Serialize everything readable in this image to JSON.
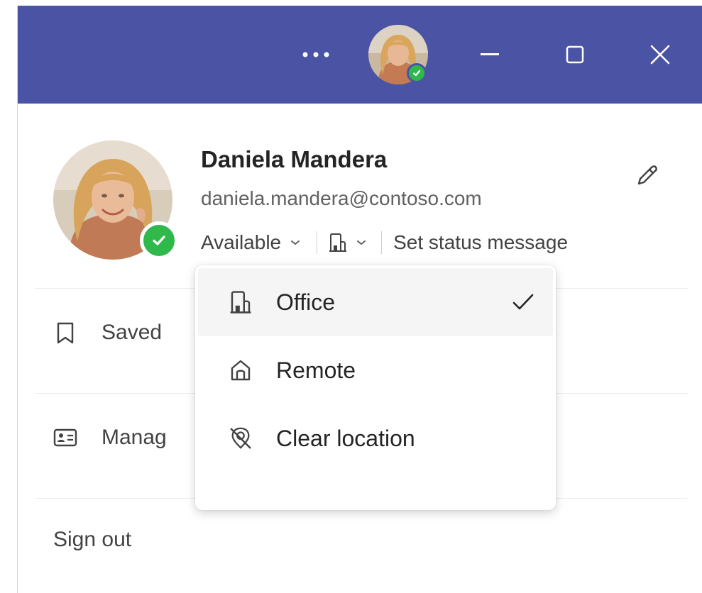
{
  "titlebar": {
    "more_label": "…",
    "accent_color": "#4b53a4"
  },
  "profile": {
    "name": "Daniela Mandera",
    "email": "daniela.mandera@contoso.com",
    "presence_color": "#2fb94a",
    "status": {
      "availability": "Available",
      "location_icon": "building-icon",
      "set_status_message": "Set status message"
    }
  },
  "menu": {
    "items": [
      {
        "label": "Saved",
        "icon": "bookmark-icon"
      },
      {
        "label": "Manag",
        "icon": "contact-card-icon"
      },
      {
        "label": "Sign out",
        "icon": ""
      }
    ]
  },
  "location_dropdown": {
    "options": [
      {
        "label": "Office",
        "icon": "building-icon",
        "selected": true
      },
      {
        "label": "Remote",
        "icon": "home-icon",
        "selected": false
      },
      {
        "label": "Clear location",
        "icon": "location-off-icon",
        "selected": false
      }
    ]
  }
}
